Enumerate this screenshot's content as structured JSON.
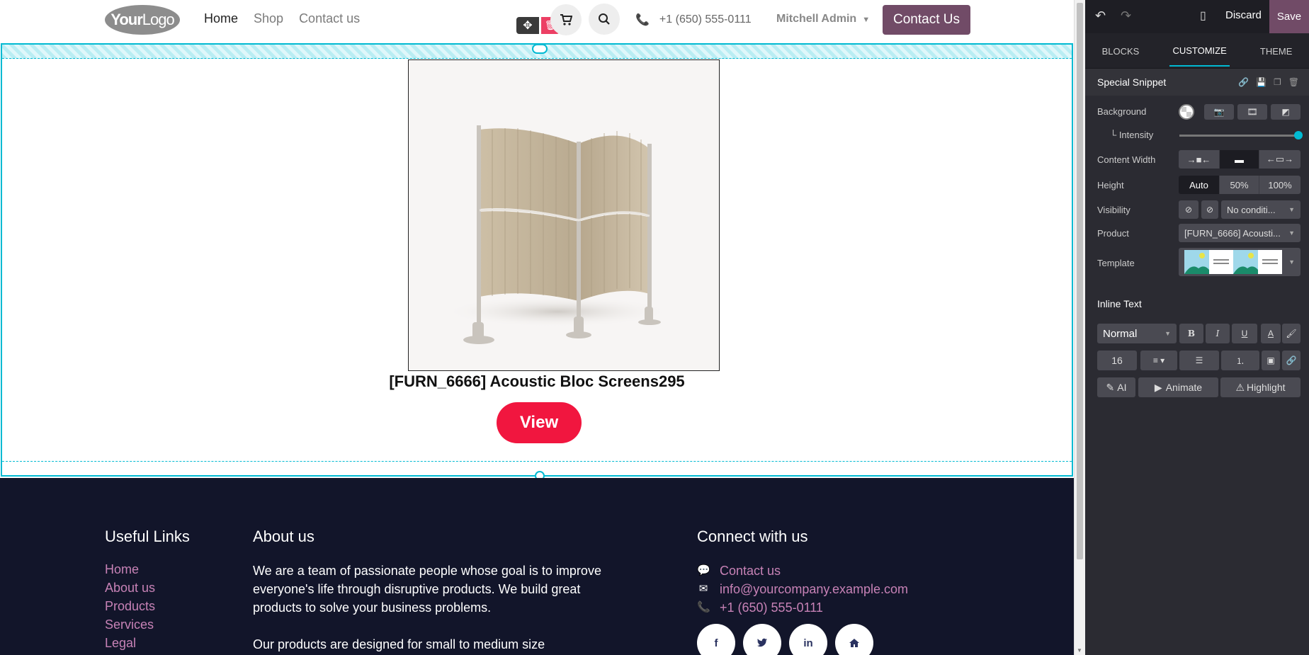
{
  "nav": {
    "logo_bold": "Your",
    "logo_rest": "Logo",
    "links": [
      "Home",
      "Shop",
      "Contact us"
    ],
    "phone": "+1 (650) 555-0111",
    "user": "Mitchell Admin",
    "cta": "Contact Us"
  },
  "snippet": {
    "product_name": "[FURN_6666] Acoustic Bloc Screens295",
    "view_label": "View"
  },
  "footer": {
    "useful_title": "Useful Links",
    "useful_links": [
      "Home",
      "About us",
      "Products",
      "Services",
      "Legal"
    ],
    "about_title": "About us",
    "about_p1": "We are a team of passionate people whose goal is to improve everyone's life through disruptive products. We build great products to solve your business problems.",
    "about_p2": "Our products are designed for small to medium size",
    "connect_title": "Connect with us",
    "connect_contact": "Contact us",
    "connect_email": "info@yourcompany.example.com",
    "connect_phone": "+1 (650) 555-0111",
    "social": [
      "f",
      "t",
      "in",
      "home"
    ]
  },
  "panel": {
    "discard": "Discard",
    "save": "Save",
    "tabs": [
      "BLOCKS",
      "CUSTOMIZE",
      "THEME"
    ],
    "active_tab": "CUSTOMIZE",
    "snippet_title": "Special Snippet",
    "labels": {
      "background": "Background",
      "intensity": "└ Intensity",
      "content_width": "Content Width",
      "height": "Height",
      "visibility": "Visibility",
      "product": "Product",
      "template": "Template"
    },
    "intensity_value": 1.0,
    "height_options": [
      "Auto",
      "50%",
      "100%"
    ],
    "height_selected": "Auto",
    "visibility_value": "No conditi...",
    "product_value": "[FURN_6666] Acousti...",
    "inline_text_title": "Inline Text",
    "text_style": "Normal",
    "font_size": "16",
    "ai_label": "AI",
    "animate_label": "Animate",
    "highlight_label": "Highlight"
  },
  "colors": {
    "accent": "#01bad2",
    "brand": "#714b67",
    "view_button": "#f1163f",
    "footer_bg": "#12152a",
    "footer_link": "#c782b6"
  }
}
